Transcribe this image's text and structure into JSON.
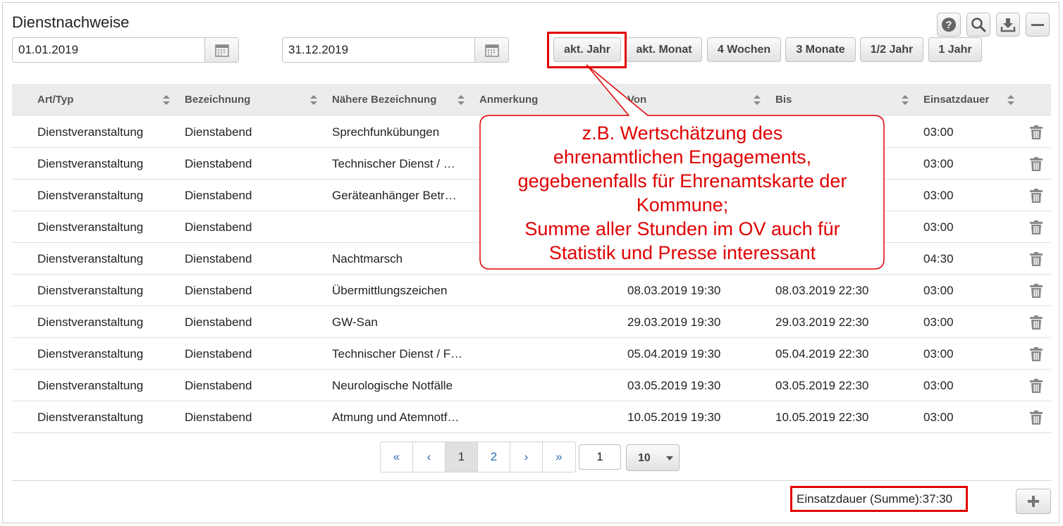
{
  "title": "Dienstnachweise",
  "date_from": "01.01.2019",
  "date_to": "31.12.2019",
  "range_buttons": [
    "akt. Jahr",
    "akt. Monat",
    "4 Wochen",
    "3 Monate",
    "1/2 Jahr",
    "1 Jahr"
  ],
  "toolbar_icons": [
    "help-icon",
    "search-icon",
    "download-icon",
    "minimize-icon"
  ],
  "columns": [
    "Art/Typ",
    "Bezeichnung",
    "Nähere Bezeichnung",
    "Anmerkung",
    "Von",
    "Bis",
    "Einsatzdauer"
  ],
  "rows": [
    {
      "art": "Dienstveranstaltung",
      "bez": "Dienstabend",
      "naehere": "Sprechfunkübungen",
      "anm": "",
      "von": "",
      "bis": "",
      "dauer": "03:00"
    },
    {
      "art": "Dienstveranstaltung",
      "bez": "Dienstabend",
      "naehere": "Technischer Dienst / …",
      "anm": "",
      "von": "",
      "bis": "",
      "dauer": "03:00"
    },
    {
      "art": "Dienstveranstaltung",
      "bez": "Dienstabend",
      "naehere": "Geräteanhänger Betr…",
      "anm": "",
      "von": "",
      "bis": "",
      "dauer": "03:00"
    },
    {
      "art": "Dienstveranstaltung",
      "bez": "Dienstabend",
      "naehere": "",
      "anm": "",
      "von": "",
      "bis": "",
      "dauer": "03:00"
    },
    {
      "art": "Dienstveranstaltung",
      "bez": "Dienstabend",
      "naehere": "Nachtmarsch",
      "anm": "",
      "von": "",
      "bis": "",
      "dauer": "04:30"
    },
    {
      "art": "Dienstveranstaltung",
      "bez": "Dienstabend",
      "naehere": "Übermittlungszeichen",
      "anm": "",
      "von": "08.03.2019 19:30",
      "bis": "08.03.2019 22:30",
      "dauer": "03:00"
    },
    {
      "art": "Dienstveranstaltung",
      "bez": "Dienstabend",
      "naehere": "GW-San",
      "anm": "",
      "von": "29.03.2019 19:30",
      "bis": "29.03.2019 22:30",
      "dauer": "03:00"
    },
    {
      "art": "Dienstveranstaltung",
      "bez": "Dienstabend",
      "naehere": "Technischer Dienst / F…",
      "anm": "",
      "von": "05.04.2019 19:30",
      "bis": "05.04.2019 22:30",
      "dauer": "03:00"
    },
    {
      "art": "Dienstveranstaltung",
      "bez": "Dienstabend",
      "naehere": "Neurologische Notfälle",
      "anm": "",
      "von": "03.05.2019 19:30",
      "bis": "03.05.2019 22:30",
      "dauer": "03:00"
    },
    {
      "art": "Dienstveranstaltung",
      "bez": "Dienstabend",
      "naehere": "Atmung und Atemnotf…",
      "anm": "",
      "von": "10.05.2019 19:30",
      "bis": "10.05.2019 22:30",
      "dauer": "03:00"
    }
  ],
  "pagination": {
    "first": "«",
    "prev": "‹",
    "pages": [
      "1",
      "2"
    ],
    "next": "›",
    "last": "»",
    "current_page": "1",
    "page_size": "10"
  },
  "sum_label": "Einsatzdauer (Summe):37:30",
  "callout": {
    "lines": [
      "z.B. Wertschätzung des",
      "ehrenamtlichen Engagements,",
      "gegebenenfalls für Ehrenamtskarte der",
      "Kommune;",
      "Summe aller Stunden im OV auch für",
      "Statistik und Presse interessant"
    ]
  },
  "colors": {
    "annotation_red": "#e00000",
    "header_bg": "#ececec",
    "link_blue": "#2a6cb8"
  }
}
